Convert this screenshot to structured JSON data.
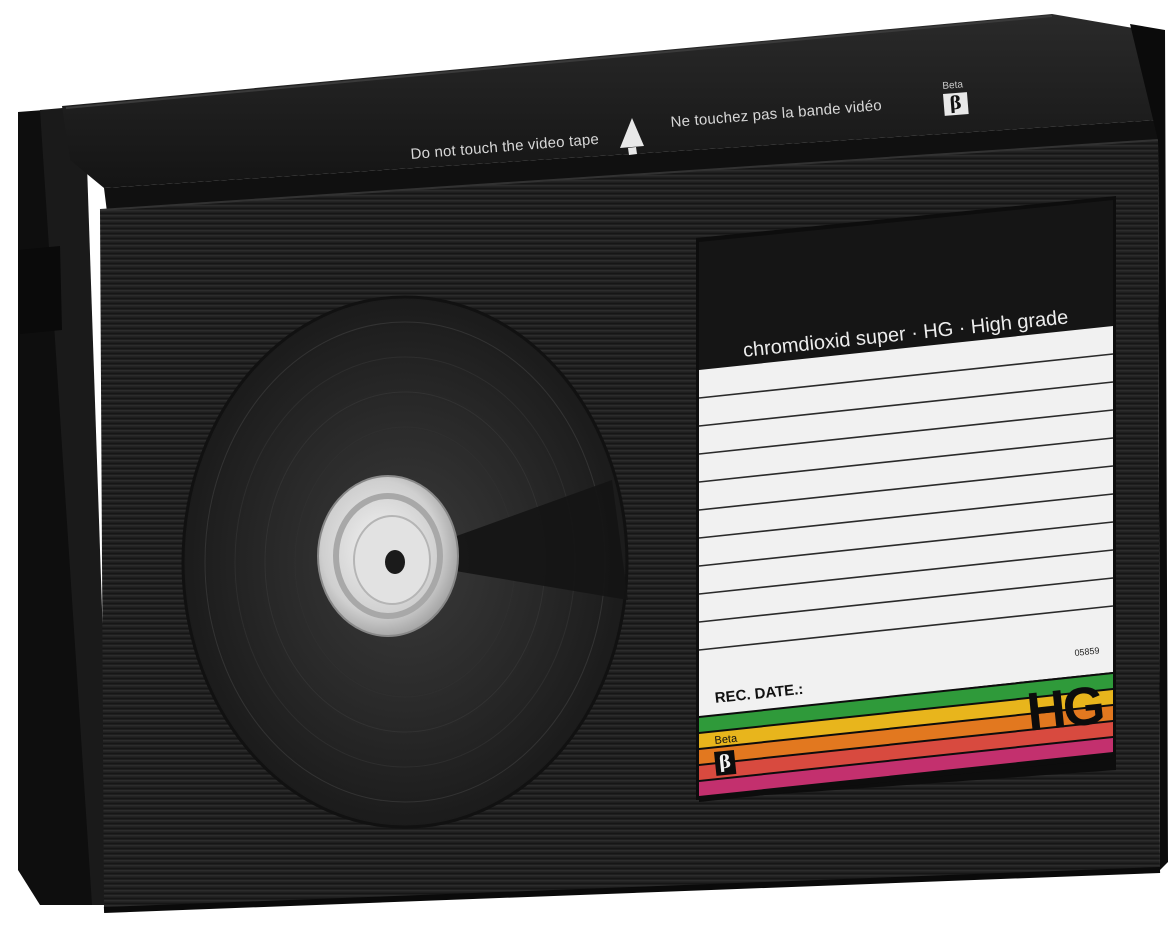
{
  "cassette": {
    "warning_en": "Do not touch the video tape",
    "warning_fr": "Ne touchez pas la bande vidéo",
    "top_logo": {
      "text": "Beta",
      "symbol": "β"
    },
    "label": {
      "title": "chromdioxid super · HG · High grade",
      "serial": "05859",
      "rec_date": "REC. DATE.:",
      "grade": "HG",
      "logo": {
        "text": "Beta",
        "symbol": "β"
      },
      "stripe_colors": [
        "#2f9a3a",
        "#e8b51c",
        "#e2781f",
        "#d84a3f",
        "#c3306e"
      ]
    },
    "colors": {
      "shell": "#1c1c1c",
      "shell_top": "#141414",
      "label_paper": "#f1f1f1",
      "label_header": "#151515"
    }
  }
}
